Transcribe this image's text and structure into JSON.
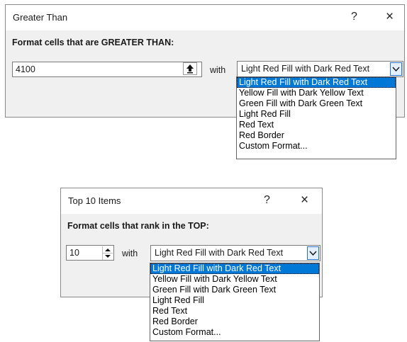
{
  "greater_than": {
    "title": "Greater Than",
    "help_glyph": "?",
    "close_glyph": "×",
    "instruction": "Format cells that are GREATER THAN:",
    "value": "4100",
    "with_label": "with",
    "selected_format": "Light Red Fill with Dark Red Text",
    "options": [
      "Light Red Fill with Dark Red Text",
      "Yellow Fill with Dark Yellow Text",
      "Green Fill with Dark Green Text",
      "Light Red Fill",
      "Red Text",
      "Red Border",
      "Custom Format..."
    ]
  },
  "top_10": {
    "title": "Top 10 Items",
    "help_glyph": "?",
    "close_glyph": "×",
    "instruction": "Format cells that rank in the TOP:",
    "value": "10",
    "with_label": "with",
    "selected_format": "Light Red Fill with Dark Red Text",
    "options": [
      "Light Red Fill with Dark Red Text",
      "Yellow Fill with Dark Yellow Text",
      "Green Fill with Dark Green Text",
      "Light Red Fill",
      "Red Text",
      "Red Border",
      "Custom Format..."
    ]
  },
  "icons": {
    "help": "help-icon",
    "close": "close-icon",
    "collapse": "collapse-dialog-icon",
    "dropdown": "chevron-down-icon",
    "spin": "spin-arrows-icon"
  },
  "colors": {
    "dialog_bg": "#f0f0f0",
    "titlebar_bg": "#ffffff",
    "selection": "#0078d7",
    "dropdown_button": "#e3efff"
  }
}
